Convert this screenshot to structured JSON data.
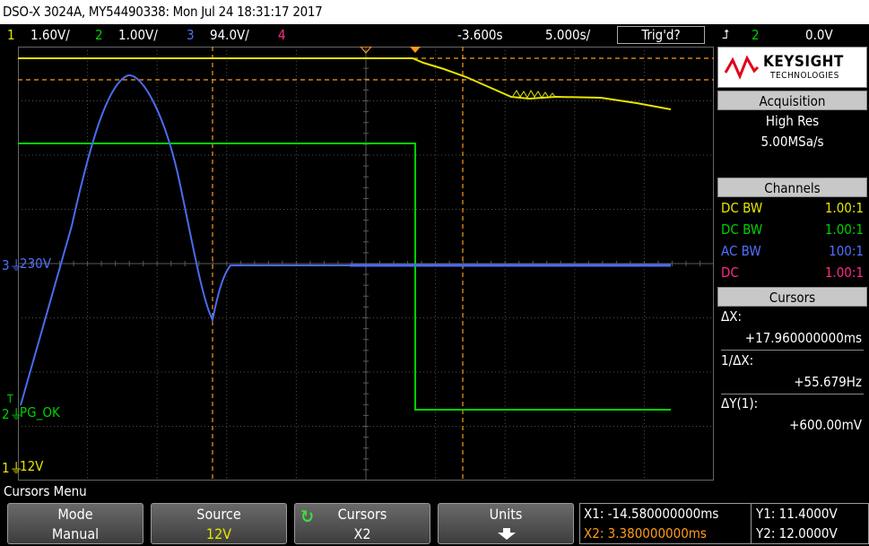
{
  "title": "DSO-X 3024A, MY54490338: Mon Jul 24 18:31:17 2017",
  "channel_bar": {
    "ch1_num": "1",
    "ch1_scale": "1.60V/",
    "ch2_num": "2",
    "ch2_scale": "1.00V/",
    "ch3_num": "3",
    "ch3_scale": "94.0V/",
    "ch4_num": "4",
    "delay": "-3.600s",
    "timebase": "5.000s/",
    "trigger_status": "Trig'd?",
    "trigger_channel": "2",
    "trigger_level": "0.0V"
  },
  "waveform_labels": {
    "ch3_label": "230V",
    "ch2_label": "PG_OK",
    "ch1_label": "12V",
    "ch3_marker": "3",
    "ch2_marker": "2",
    "ch1_marker": "1",
    "trigger_marker": "T"
  },
  "brand": {
    "name": "KEYSIGHT",
    "sub": "TECHNOLOGIES"
  },
  "acquisition": {
    "header": "Acquisition",
    "mode": "High Res",
    "rate": "5.00MSa/s"
  },
  "channels": {
    "header": "Channels",
    "rows": [
      {
        "coupling": "DC BW",
        "probe": "1.00:1",
        "color": "#e6e600"
      },
      {
        "coupling": "DC BW",
        "probe": "1.00:1",
        "color": "#00d000"
      },
      {
        "coupling": "AC BW",
        "probe": "100:1",
        "color": "#5070ff"
      },
      {
        "coupling": "DC",
        "probe": "1.00:1",
        "color": "#ff2a8a"
      }
    ]
  },
  "cursors_panel": {
    "header": "Cursors",
    "dx_label": "ΔX:",
    "dx_value": "+17.960000000ms",
    "inv_label": "1/ΔX:",
    "inv_value": "+55.679Hz",
    "dy_label": "ΔY(1):",
    "dy_value": "+600.00mV"
  },
  "menu_title": "Cursors Menu",
  "softkeys": [
    {
      "label": "Mode",
      "value": "Manual"
    },
    {
      "label": "Source",
      "value": "12V"
    },
    {
      "label": "Cursors",
      "value": "X2"
    },
    {
      "label": "Units",
      "value": ""
    }
  ],
  "cursor_info": {
    "x1": "X1: -14.580000000ms",
    "x2": "X2: 3.380000000ms",
    "y1": "Y1: 11.4000V",
    "y2": "Y2: 12.0000V"
  },
  "colors": {
    "ch1": "#e6e600",
    "ch2": "#00d000",
    "ch3": "#4a6cf0",
    "ch4": "#ff2a8a",
    "cursor": "#ff9a1a",
    "grid": "#5a5a5a"
  }
}
